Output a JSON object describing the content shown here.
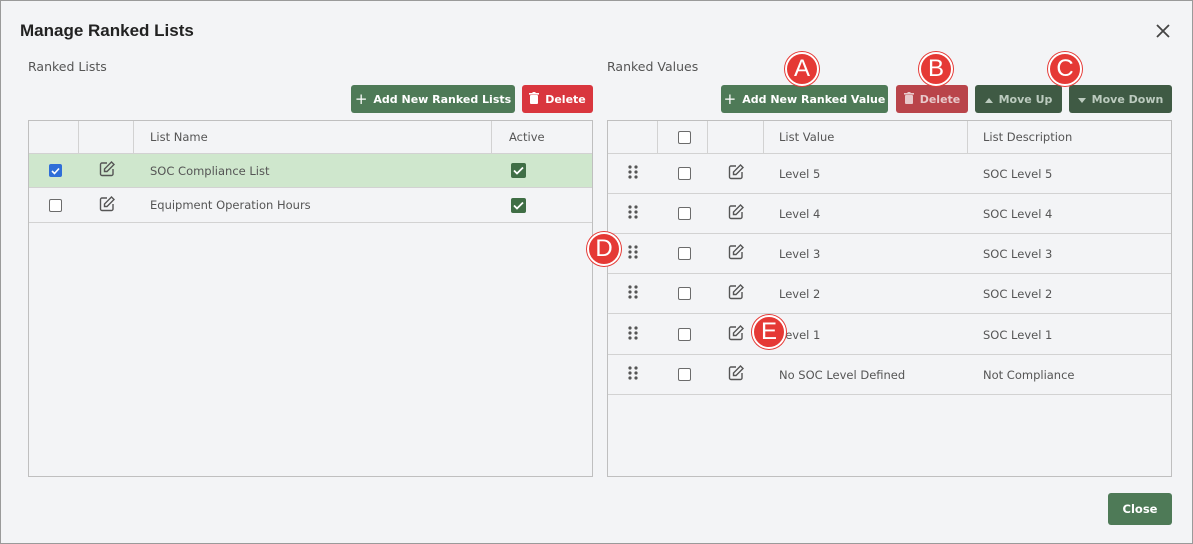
{
  "dialog": {
    "title": "Manage Ranked Lists",
    "close_button_label": "Close"
  },
  "ranked_lists": {
    "section_label": "Ranked Lists",
    "add_button_label": "Add New Ranked Lists",
    "delete_button_label": "Delete",
    "columns": [
      "",
      "",
      "List Name",
      "Active"
    ],
    "rows": [
      {
        "name": "SOC Compliance List",
        "selected": true,
        "active": true
      },
      {
        "name": "Equipment Operation Hours",
        "selected": false,
        "active": true
      }
    ]
  },
  "ranked_values": {
    "section_label": "Ranked Values",
    "add_button_label": "Add New Ranked Value",
    "delete_button_label": "Delete",
    "move_up_label": "Move Up",
    "move_down_label": "Move Down",
    "columns": [
      "",
      "",
      "",
      "List Value",
      "List Description"
    ],
    "rows": [
      {
        "value": "Level 5",
        "description": "SOC Level 5"
      },
      {
        "value": "Level 4",
        "description": "SOC Level 4"
      },
      {
        "value": "Level 3",
        "description": "SOC Level 3"
      },
      {
        "value": "Level 2",
        "description": "SOC Level 2"
      },
      {
        "value": "Level 1",
        "description": "SOC Level 1"
      },
      {
        "value": "No SOC Level Defined",
        "description": "Not Compliance"
      }
    ]
  },
  "markers": [
    "A",
    "B",
    "C",
    "D",
    "E"
  ],
  "colors": {
    "primary_green": "#4e7a57",
    "danger_red": "#d9363e",
    "marker_red": "#e53935",
    "selected_row": "#cfe7cd",
    "checkbox_blue": "#2f6ed8"
  }
}
